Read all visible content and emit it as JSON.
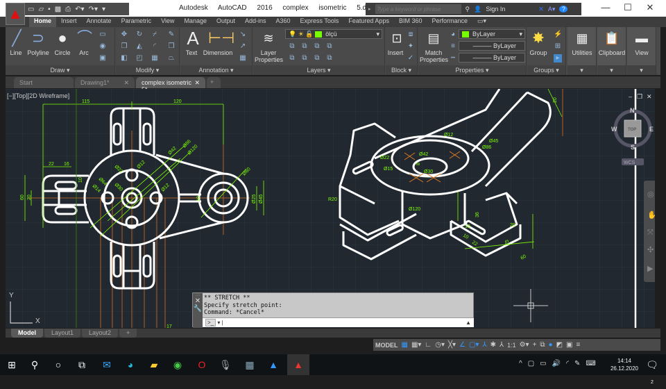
{
  "app": {
    "title": "Autodesk AutoCAD 2016",
    "file": "complex isometric 5.dwg",
    "logo": "A"
  },
  "search": {
    "placeholder": "Type a keyword or phrase",
    "sign_in": "Sign In"
  },
  "ribbon_tabs": [
    "Home",
    "Insert",
    "Annotate",
    "Parametric",
    "View",
    "Manage",
    "Output",
    "Add-ins",
    "A360",
    "Express Tools",
    "Featured Apps",
    "BIM 360",
    "Performance"
  ],
  "panels": {
    "draw": "Draw",
    "modify": "Modify",
    "annotation": "Annotation",
    "layers": "Layers",
    "block": "Block",
    "properties": "Properties",
    "groups": "Groups"
  },
  "buttons": {
    "line": "Line",
    "polyline": "Polyline",
    "circle": "Circle",
    "arc": "Arc",
    "text": "Text",
    "dimension": "Dimension",
    "layer_properties_1": "Layer",
    "layer_properties_2": "Properties",
    "insert": "Insert",
    "match_1": "Match",
    "match_2": "Properties",
    "group": "Group",
    "utilities": "Utilities",
    "clipboard": "Clipboard",
    "view": "View"
  },
  "layer_current": "ölçü",
  "properties": {
    "color": "ByLayer",
    "linetype": "ByLayer",
    "lineweight": "ByLayer",
    "color_hex": "#7fff00"
  },
  "file_tabs": [
    {
      "label": "Start"
    },
    {
      "label": "Drawing1*"
    },
    {
      "label": "complex isometric 5*"
    }
  ],
  "viewport": {
    "label": "[−][Top][2D Wireframe]",
    "viewcube": {
      "n": "N",
      "s": "S",
      "e": "E",
      "w": "W",
      "top": "TOP",
      "wcs": "WCS"
    },
    "ucs_x": "X",
    "ucs_y": "Y"
  },
  "dims_top": [
    "115",
    "120",
    "22",
    "16",
    "60",
    "20",
    "10",
    "Ø22",
    "Ø12",
    "Ø64",
    "Ø30",
    "Ø14",
    "Ø42",
    "Ø86",
    "Ø120",
    "Ø12",
    "Ø60",
    "Ø25",
    "Ø45",
    "10",
    "17"
  ],
  "dims_iso": [
    "Ø12",
    "Ø45",
    "Ø86",
    "Ø42",
    "Ø22",
    "Ø15",
    "Ø30",
    "R20",
    "Ø120",
    "36",
    "20",
    "25",
    "60",
    "10",
    "22",
    "20",
    "10",
    "8"
  ],
  "command": {
    "lines": [
      "** STRETCH **",
      "Specify stretch point:",
      "Command: *Cancel*"
    ],
    "input": ""
  },
  "layout_tabs": [
    "Model",
    "Layout1",
    "Layout2"
  ],
  "status": {
    "model": "MODEL",
    "scale": "1:1"
  },
  "taskbar": {
    "time": "14:14",
    "date": "26.12.2020",
    "notifications": "2"
  },
  "colors": {
    "accent_green": "#7fff00",
    "centerline": "#e07a20",
    "background": "#212830"
  }
}
